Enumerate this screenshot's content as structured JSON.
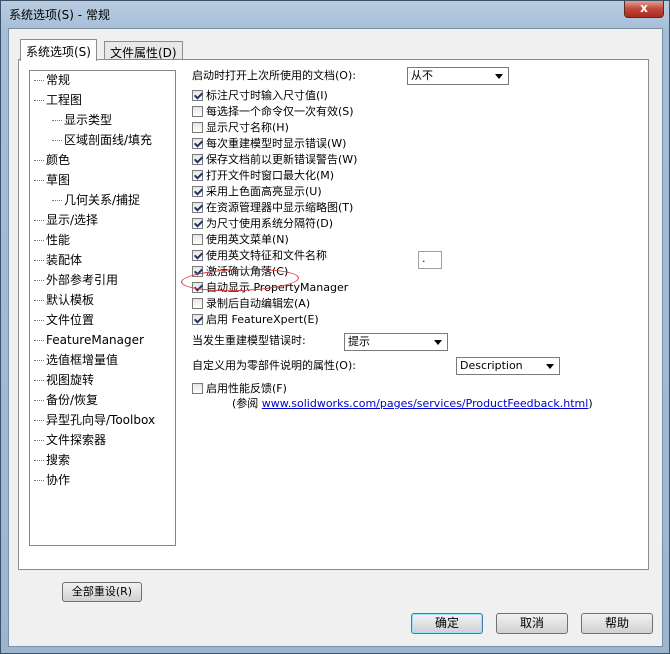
{
  "window": {
    "title": "系统选项(S) - 常规",
    "close_label": "x"
  },
  "tabs": [
    {
      "label": "系统选项(S)"
    },
    {
      "label": "文件属性(D)"
    }
  ],
  "tree": {
    "items": [
      {
        "label": "常规"
      },
      {
        "label": "工程图"
      },
      {
        "label": "显示类型"
      },
      {
        "label": "区域剖面线/填充"
      },
      {
        "label": "颜色"
      },
      {
        "label": "草图"
      },
      {
        "label": "几何关系/捕捉"
      },
      {
        "label": "显示/选择"
      },
      {
        "label": "性能"
      },
      {
        "label": "装配体"
      },
      {
        "label": "外部参考引用"
      },
      {
        "label": "默认模板"
      },
      {
        "label": "文件位置"
      },
      {
        "label": "FeatureManager"
      },
      {
        "label": "选值框增量值"
      },
      {
        "label": "视图旋转"
      },
      {
        "label": "备份/恢复"
      },
      {
        "label": "异型孔向导/Toolbox"
      },
      {
        "label": "文件探索器"
      },
      {
        "label": "搜索"
      },
      {
        "label": "协作"
      }
    ],
    "reset_label": "全部重设(R)"
  },
  "options": {
    "open_last_label": "启动时打开上次所使用的文档(O):",
    "open_last_value": "从不",
    "checkboxes": [
      {
        "label": "标注尺寸时输入尺寸值(I)",
        "checked": true
      },
      {
        "label": "每选择一个命令仅一次有效(S)",
        "checked": false
      },
      {
        "label": "显示尺寸名称(H)",
        "checked": false
      },
      {
        "label": "每次重建模型时显示错误(W)",
        "checked": true
      },
      {
        "label": "保存文档前以更新错误警告(W)",
        "checked": true
      },
      {
        "label": "打开文件时窗口最大化(M)",
        "checked": true
      },
      {
        "label": "采用上色面高亮显示(U)",
        "checked": true
      },
      {
        "label": "在资源管理器中显示缩略图(T)",
        "checked": true
      },
      {
        "label": "为尺寸使用系统分隔符(D)",
        "checked": true
      },
      {
        "label": "使用英文菜单(N)",
        "checked": false
      },
      {
        "label": "使用英文特征和文件名称",
        "checked": true
      },
      {
        "label": "激活确认角落(C)",
        "checked": true
      },
      {
        "label": "自动显示 PropertyManager",
        "checked": true
      },
      {
        "label": "录制后自动编辑宏(A)",
        "checked": false
      },
      {
        "label": "启用 FeatureXpert(E)",
        "checked": true
      }
    ],
    "separator_value": ".",
    "rebuild_error_label": "当发生重建模型错误时:",
    "rebuild_error_value": "提示",
    "custom_prop_label": "自定义用为零部件说明的属性(O):",
    "custom_prop_value": "Description",
    "feedback_label": "启用性能反馈(F)",
    "feedback_checked": false,
    "feedback_ref_prefix": "(参阅",
    "feedback_url": "www.solidworks.com/pages/services/ProductFeedback.html",
    "feedback_ref_suffix": ")"
  },
  "buttons": {
    "ok": "确定",
    "cancel": "取消",
    "help": "帮助"
  }
}
